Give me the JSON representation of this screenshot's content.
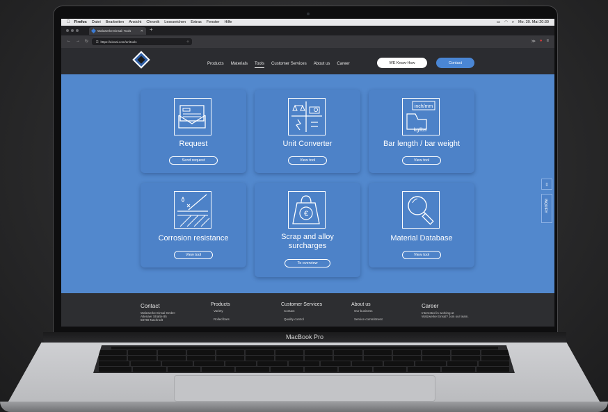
{
  "menubar": {
    "apple": "",
    "items": [
      "Firefox",
      "Datei",
      "Bearbeiten",
      "Ansicht",
      "Chronik",
      "Lesezeichen",
      "Extras",
      "Fenster",
      "Hilfe"
    ],
    "clock": "Mo. 30. Mai 20:30"
  },
  "browser": {
    "tab_title": "Walzwerke Einsal: Tools",
    "url": "https://einsal.com/en/tools"
  },
  "site": {
    "nav": [
      "Products",
      "Materials",
      "Tools",
      "Customer Services",
      "About us",
      "Career"
    ],
    "know_how_btn": "WE Know-How",
    "contact_btn": "Contact",
    "side_inquiry": "INQUIRY"
  },
  "cards": [
    {
      "title": "Request",
      "button": "Send request",
      "icon": "envelope-icon"
    },
    {
      "title": "Unit Converter",
      "button": "View tool",
      "icon": "converter-icon"
    },
    {
      "title": "Bar length / bar weight",
      "button": "View tool",
      "icon": "weight-conversion-icon",
      "icon_top": "inch/mm",
      "icon_bottom": "kg/lbs"
    },
    {
      "title": "Corrosion resistance",
      "button": "View tool",
      "icon": "corrosion-icon"
    },
    {
      "title": "Scrap and alloy surcharges",
      "button": "To overview",
      "icon": "euro-weight-icon"
    },
    {
      "title": "Material Database",
      "button": "View tool",
      "icon": "magnifier-icon"
    }
  ],
  "footer": {
    "contact": {
      "heading": "Contact",
      "lines": [
        "Walzwerke Einsal GmbH",
        "Altenaer Straße 85",
        "58769 Nachrodt"
      ]
    },
    "products": {
      "heading": "Products",
      "lines": [
        "Variety",
        "Rolled bars"
      ]
    },
    "services": {
      "heading": "Customer Services",
      "lines": [
        "Contact",
        "Quality control"
      ]
    },
    "about": {
      "heading": "About us",
      "lines": [
        "Our business",
        "Service commitment"
      ]
    },
    "career": {
      "heading": "Career",
      "lines": [
        "Interested in working at",
        "Walzwerke Einsal? Join our team."
      ]
    }
  },
  "laptop": {
    "model_label": "MacBook Pro"
  }
}
